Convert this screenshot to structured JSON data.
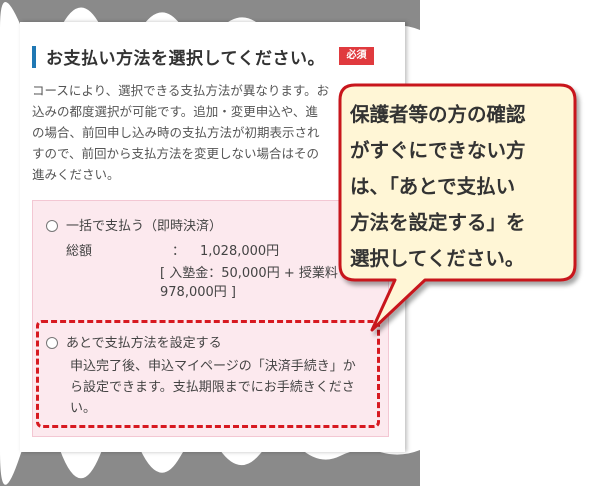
{
  "section": {
    "title": "お支払い方法を選択してください。",
    "required_badge": "必須"
  },
  "description": {
    "lines": [
      "コースにより、選択できる支払方法が異なります。お",
      "込みの都度選択が可能です。追加・変更申込や、進",
      "の場合、前回申し込み時の支払方法が初期表示され",
      "すので、前回から支払方法を変更しない場合はその",
      "進みください。"
    ]
  },
  "options": {
    "lump_sum": {
      "label": "一括で支払う（即時決済）",
      "total_label": "総額",
      "total_colon": "：",
      "total_value": "1,028,000円",
      "breakdown_line1": "[ 入塾金：50,000円 + 授業料",
      "breakdown_line2": "978,000円 ]"
    },
    "later": {
      "label": "あとで支払方法を設定する",
      "desc_lines": [
        "申込完了後、申込マイページの「決済手続き」か",
        "ら設定できます。支払期限までにお手続きくださ",
        "い。"
      ]
    }
  },
  "callout": {
    "lines": [
      "保護者等の方の確認",
      "がすぐにできない方",
      "は、「あとで支払い",
      "方法を設定する」を",
      "選択してください。"
    ]
  },
  "colors": {
    "accent_blue": "#1f78b4",
    "required_red": "#e03a3e",
    "highlight_red": "#d71920",
    "option_bg": "#fce9ee",
    "callout_bg": "#fff6d6"
  }
}
